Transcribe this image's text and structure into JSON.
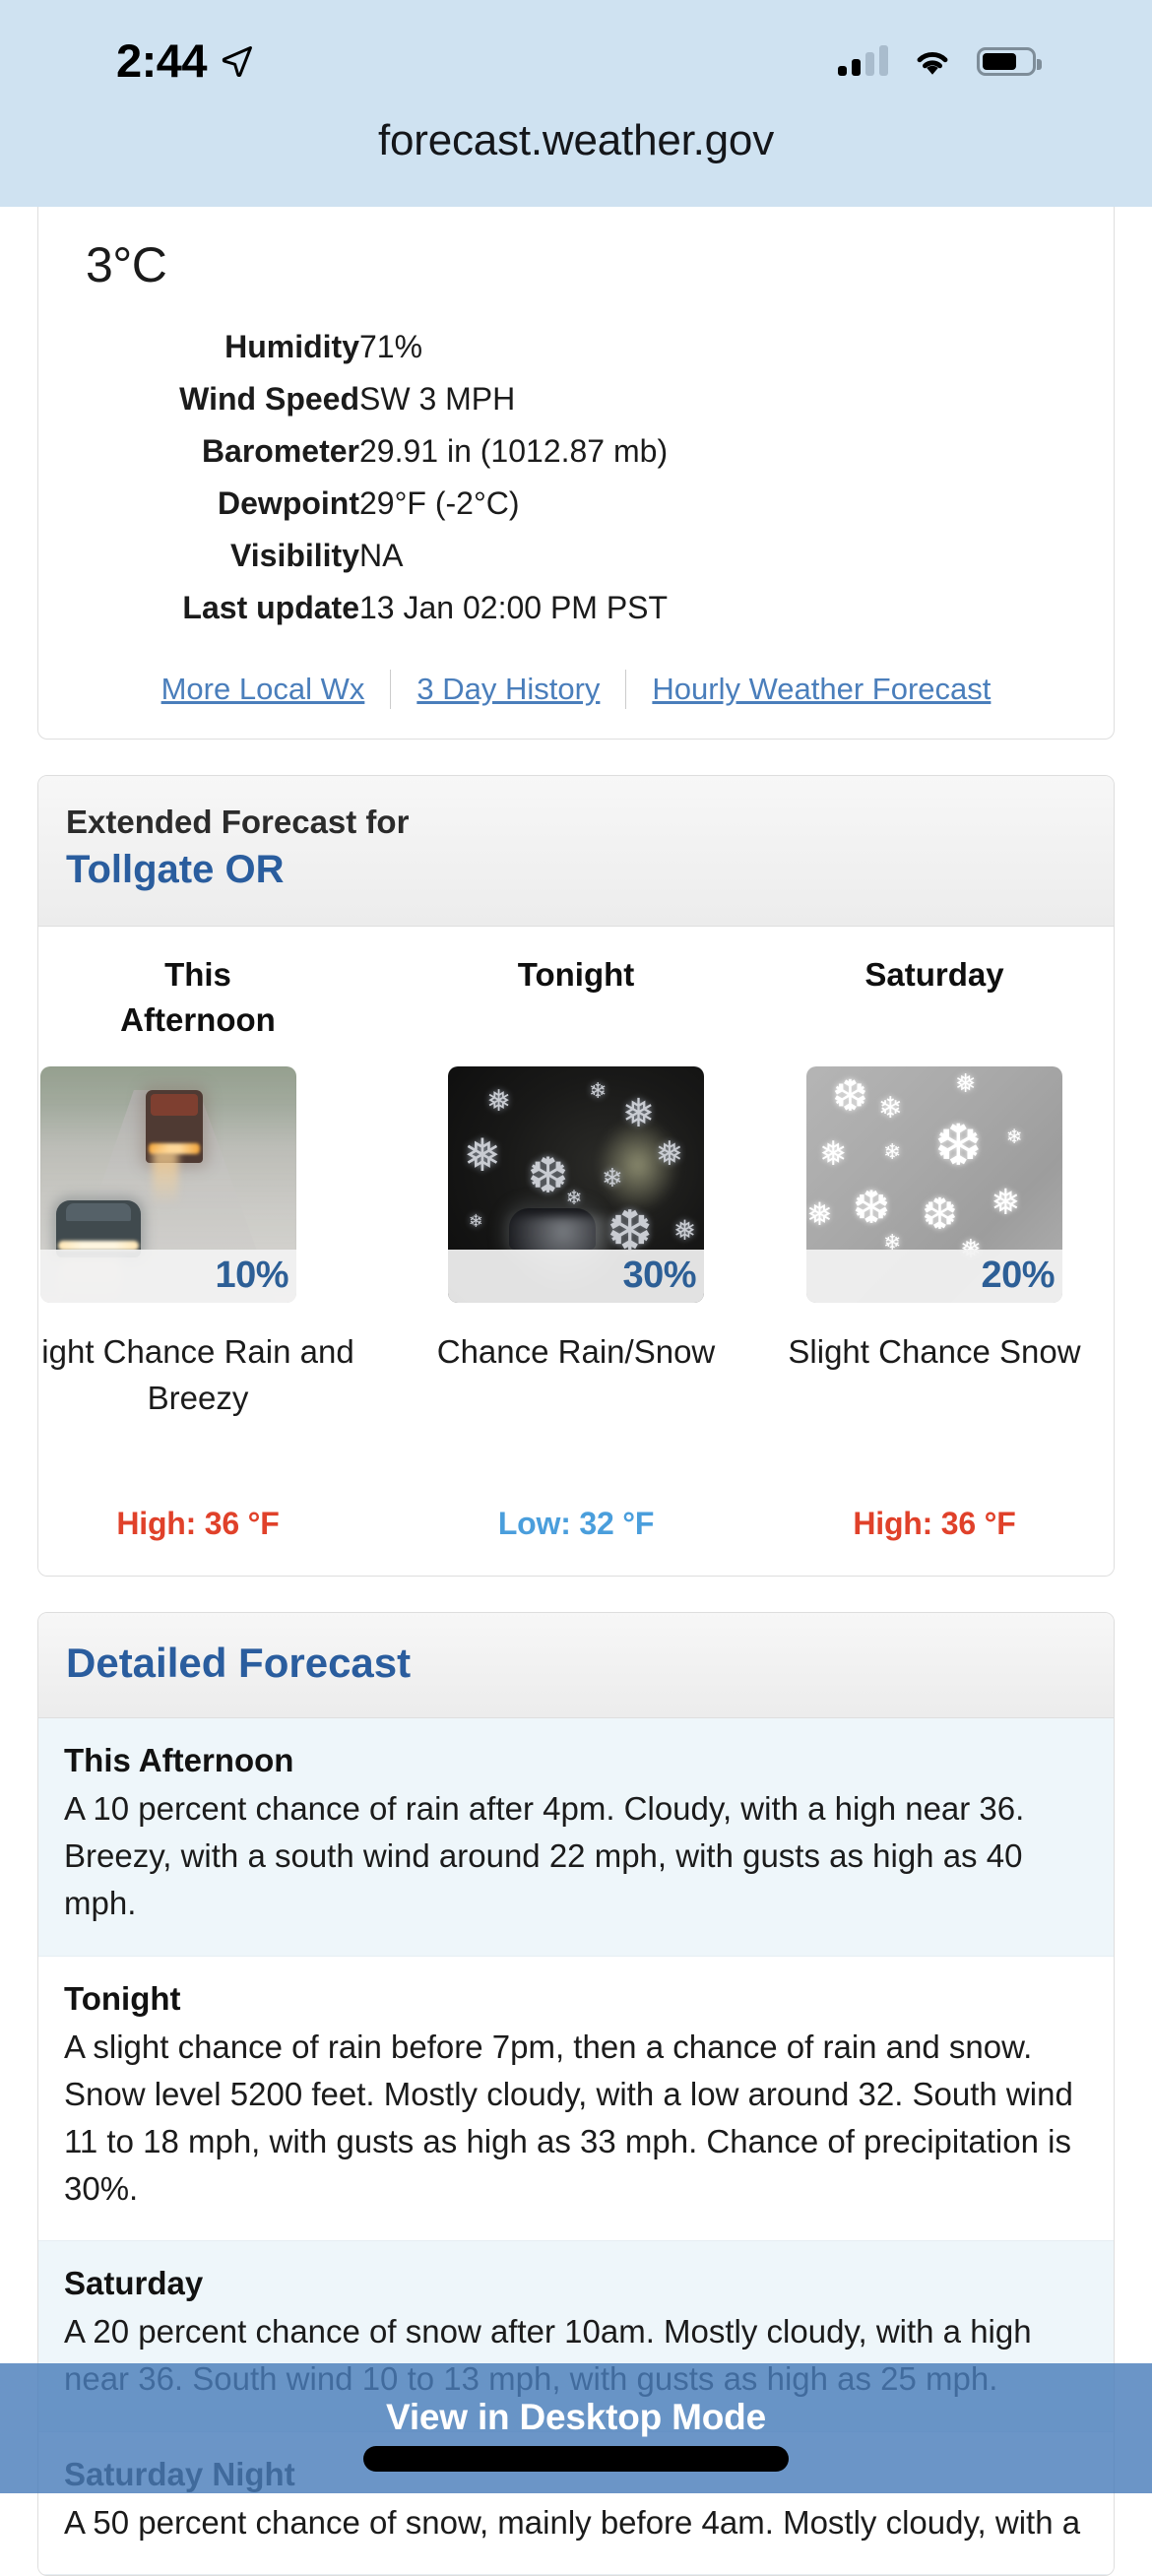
{
  "status_bar": {
    "time": "2:44",
    "location_icon": "location-arrow-icon",
    "signal_icon": "cellular-signal-icon",
    "wifi_icon": "wifi-icon",
    "battery_icon": "battery-icon",
    "battery_level_percent": 70,
    "signal_bars_filled": 2,
    "signal_bars_total": 4
  },
  "browser": {
    "url": "forecast.weather.gov",
    "header_bg": "#cfe2f1"
  },
  "current_conditions": {
    "temperature_c": "3°C",
    "rows": [
      {
        "label": "Humidity",
        "value": "71%"
      },
      {
        "label": "Wind Speed",
        "value": "SW 3 MPH"
      },
      {
        "label": "Barometer",
        "value": "29.91 in (1012.87 mb)"
      },
      {
        "label": "Dewpoint",
        "value": "29°F (-2°C)"
      },
      {
        "label": "Visibility",
        "value": "NA"
      },
      {
        "label": "Last update",
        "value": "13 Jan 02:00 PM PST"
      }
    ],
    "links": [
      {
        "label": "More Local Wx"
      },
      {
        "label": "3 Day History"
      },
      {
        "label": "Hourly Weather Forecast"
      }
    ]
  },
  "extended_forecast": {
    "heading": "Extended Forecast for",
    "location": "Tollgate OR",
    "cards": [
      {
        "name": "This Afternoon",
        "name_clipped": "This",
        "name_clipped2": "Afternoon",
        "icon": "rainy-road-photo-icon",
        "pop": "10%",
        "description": "ight Chance Rain and Breezy",
        "full_description": "Slight Chance Rain and Breezy",
        "temp_label": "High:",
        "temp_label_clipped": "High: 36 °F",
        "temp_value": "36 °F",
        "temp_type": "high"
      },
      {
        "name": "Tonight",
        "icon": "night-snow-icon",
        "pop": "30%",
        "description": "Chance Rain/Snow",
        "temp_label": "Low:",
        "temp_value": "32 °F",
        "temp_full": "Low: 32 °F",
        "temp_type": "low"
      },
      {
        "name": "Saturday",
        "icon": "snow-icon",
        "pop": "20%",
        "description": "Slight Chance Snow",
        "temp_label": "High:",
        "temp_value": "36 °F",
        "temp_full": "High: 36 °F",
        "temp_type": "high"
      }
    ]
  },
  "detailed_forecast": {
    "title": "Detailed Forecast",
    "periods": [
      {
        "name": "This Afternoon",
        "text": "A 10 percent chance of rain after 4pm. Cloudy, with a high near 36. Breezy, with a south wind around 22 mph, with gusts as high as 40 mph."
      },
      {
        "name": "Tonight",
        "text": "A slight chance of rain before 7pm, then a chance of rain and snow. Snow level 5200 feet. Mostly cloudy, with a low around 32. South wind 11 to 18 mph, with gusts as high as 33 mph. Chance of precipitation is 30%."
      },
      {
        "name": "Saturday",
        "text": "A 20 percent chance of snow after 10am. Mostly cloudy, with a high near 36. South wind 10 to 13 mph, with gusts as high as 25 mph."
      },
      {
        "name": "Saturday Night",
        "text": "A 50 percent chance of snow, mainly before 4am. Mostly cloudy, with a"
      }
    ]
  },
  "bottom_bar": {
    "label": "View in Desktop Mode",
    "bg_color": "#4a7ebb"
  },
  "colors": {
    "link_blue": "#4a7ebb",
    "heading_blue": "#2a5d9e",
    "high_red": "#e0412a",
    "low_blue": "#4a9edc",
    "pop_blue": "#2d5f96"
  }
}
